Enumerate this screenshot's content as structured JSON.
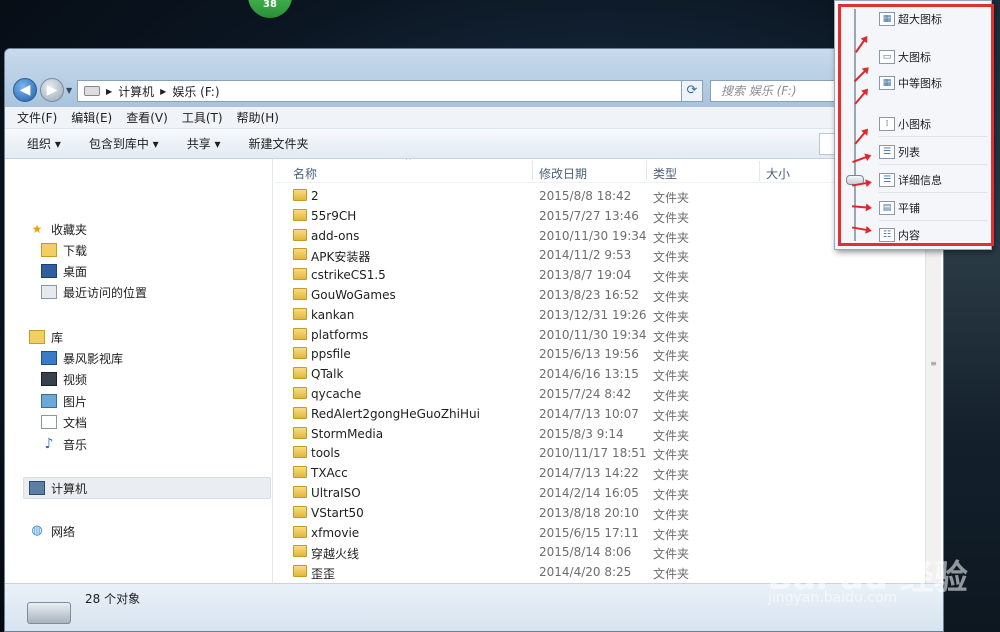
{
  "badge": "38",
  "nav_buttons": {
    "back": "◀",
    "forward": "▶",
    "dropdown": "▼"
  },
  "address": {
    "parts": [
      "计算机",
      "娱乐 (F:)"
    ]
  },
  "search": {
    "placeholder": "搜索 娱乐 (F:)"
  },
  "menu": [
    "文件(F)",
    "编辑(E)",
    "查看(V)",
    "工具(T)",
    "帮助(H)"
  ],
  "toolbar": {
    "organize": "组织 ▾",
    "include": "包含到库中 ▾",
    "share": "共享 ▾",
    "new_folder": "新建文件夹"
  },
  "sidebar": {
    "favorites": {
      "title": "收藏夹",
      "items": [
        "下载",
        "桌面",
        "最近访问的位置"
      ]
    },
    "libraries": {
      "title": "库",
      "items": [
        "暴风影视库",
        "视频",
        "图片",
        "文档",
        "音乐"
      ]
    },
    "computer": "计算机",
    "network": "网络"
  },
  "columns": {
    "name": "名称",
    "date": "修改日期",
    "type": "类型",
    "size": "大小"
  },
  "files": [
    {
      "name": "2",
      "date": "2015/8/8 18:42",
      "type": "文件夹"
    },
    {
      "name": "55r9CH",
      "date": "2015/7/27 13:46",
      "type": "文件夹"
    },
    {
      "name": "add-ons",
      "date": "2010/11/30 19:34",
      "type": "文件夹"
    },
    {
      "name": "APK安装器",
      "date": "2014/11/2 9:53",
      "type": "文件夹"
    },
    {
      "name": "cstrikeCS1.5",
      "date": "2013/8/7 19:04",
      "type": "文件夹"
    },
    {
      "name": "GouWoGames",
      "date": "2013/8/23 16:52",
      "type": "文件夹"
    },
    {
      "name": "kankan",
      "date": "2013/12/31 19:26",
      "type": "文件夹"
    },
    {
      "name": "platforms",
      "date": "2010/11/30 19:34",
      "type": "文件夹"
    },
    {
      "name": "ppsfile",
      "date": "2015/6/13 19:56",
      "type": "文件夹"
    },
    {
      "name": "QTalk",
      "date": "2014/6/16 13:15",
      "type": "文件夹"
    },
    {
      "name": "qycache",
      "date": "2015/7/24 8:42",
      "type": "文件夹"
    },
    {
      "name": "RedAlert2gongHeGuoZhiHui",
      "date": "2014/7/13 10:07",
      "type": "文件夹"
    },
    {
      "name": "StormMedia",
      "date": "2015/8/3 9:14",
      "type": "文件夹"
    },
    {
      "name": "tools",
      "date": "2010/11/17 18:51",
      "type": "文件夹"
    },
    {
      "name": "TXAcc",
      "date": "2014/7/13 14:22",
      "type": "文件夹"
    },
    {
      "name": "UltraISO",
      "date": "2014/2/14 16:05",
      "type": "文件夹"
    },
    {
      "name": "VStart50",
      "date": "2013/8/18 20:10",
      "type": "文件夹"
    },
    {
      "name": "xfmovie",
      "date": "2015/6/15 17:11",
      "type": "文件夹"
    },
    {
      "name": "穿越火线",
      "date": "2015/8/14 8:06",
      "type": "文件夹"
    },
    {
      "name": "歪歪",
      "date": "2014/4/20 8:25",
      "type": "文件夹"
    }
  ],
  "status": {
    "count": "28 个对象"
  },
  "view_menu": [
    "超大图标",
    "大图标",
    "中等图标",
    "小图标",
    "列表",
    "详细信息",
    "平铺",
    "内容"
  ],
  "watermark": {
    "main": "Bai du 经验",
    "sub": "jingyan.baidu.com"
  },
  "colors": {
    "highlight": "#e23030",
    "accent": "#1a5ea8"
  }
}
